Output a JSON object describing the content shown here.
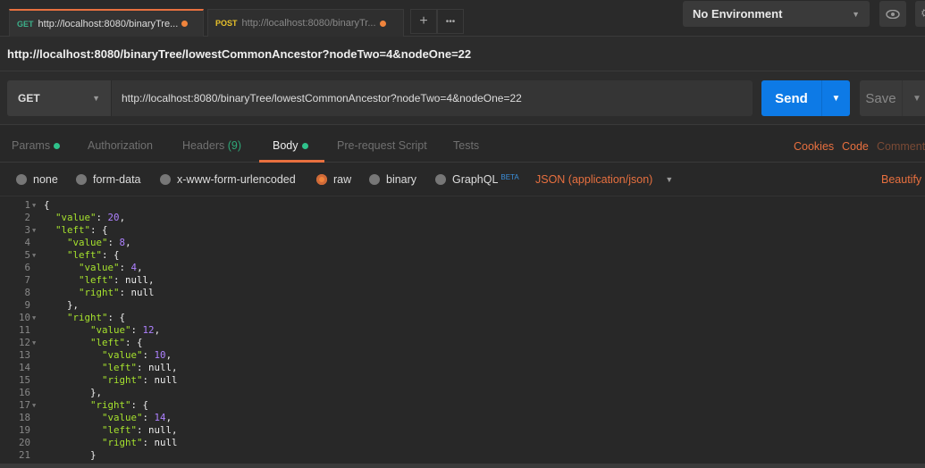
{
  "tabs": [
    {
      "method": "GET",
      "title": "http://localhost:8080/binaryTre...",
      "unsaved": true
    },
    {
      "method": "POST",
      "title": "http://localhost:8080/binaryTr...",
      "unsaved": true
    }
  ],
  "new_tab_icon": "+",
  "more_icon": "•••",
  "environment": "No Environment",
  "eye_icon": "eye-icon",
  "settings_icon": "gear-icon",
  "request_title": "http://localhost:8080/binaryTree/lowestCommonAncestor?nodeTwo=4&nodeOne=22",
  "request": {
    "method": "GET",
    "url": "http://localhost:8080/binaryTree/lowestCommonAncestor?nodeTwo=4&nodeOne=22",
    "send": "Send",
    "save": "Save"
  },
  "req_tabs": {
    "params": "Params",
    "authorization": "Authorization",
    "headers": "Headers",
    "headers_count": "(9)",
    "body": "Body",
    "prerequest": "Pre-request Script",
    "tests": "Tests"
  },
  "links": {
    "cookies": "Cookies",
    "code": "Code",
    "comments": "Comments"
  },
  "body_types": {
    "none": "none",
    "form_data": "form-data",
    "urlencoded": "x-www-form-urlencoded",
    "raw": "raw",
    "binary": "binary",
    "graphql": "GraphQL",
    "beta": "BETA",
    "selected": "raw"
  },
  "content_type": "JSON (application/json)",
  "beautify": "Beautify",
  "code_lines": [
    "{",
    "  \"value\": 20,",
    "  \"left\": {",
    "    \"value\": 8,",
    "    \"left\": {",
    "      \"value\": 4,",
    "      \"left\": null,",
    "      \"right\": null",
    "    },",
    "    \"right\": {",
    "        \"value\": 12,",
    "        \"left\": {",
    "          \"value\": 10,",
    "          \"left\": null,",
    "          \"right\": null",
    "        },",
    "        \"right\": {",
    "          \"value\": 14,",
    "          \"left\": null,",
    "          \"right\": null",
    "        }",
    "    }"
  ],
  "fold_lines": [
    1,
    3,
    5,
    10,
    12,
    17
  ]
}
